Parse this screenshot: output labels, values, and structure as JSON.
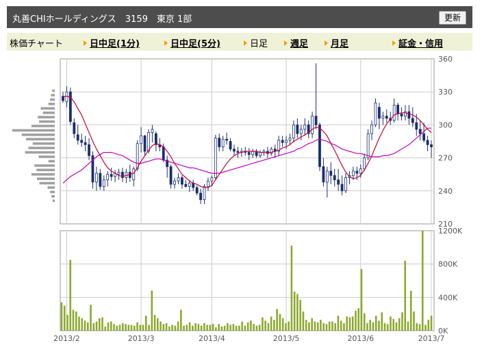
{
  "header": {
    "title": "丸善CHIホールディングス　3159　東京 1部",
    "refresh_label": "更新"
  },
  "nav": {
    "chart_label": "株価チャート",
    "items": [
      {
        "label": "日中足(1分)",
        "link": true
      },
      {
        "label": "日中足(5分)",
        "link": true
      },
      {
        "label": "日足",
        "link": false
      },
      {
        "label": "週足",
        "link": true
      },
      {
        "label": "月足",
        "link": true
      },
      {
        "label": "証金・信用",
        "link": true
      }
    ]
  },
  "colors": {
    "candle": "#1a2e6e",
    "ma_short": "#cc0033",
    "ma_long": "#c000c0",
    "volume": "#8ca82e",
    "volume_profile": "#a0a0a0",
    "grid": "#cccccc"
  },
  "chart_data": {
    "type": "candlestick",
    "price_axis": {
      "min": 210,
      "max": 360,
      "ticks": [
        210,
        240,
        270,
        300,
        330,
        360
      ]
    },
    "volume_axis": {
      "min": 0,
      "max": 1200000,
      "ticks": [
        0,
        400000,
        800000,
        1200000
      ],
      "tick_labels": [
        "0K",
        "400K",
        "800K",
        "1200K"
      ]
    },
    "x_labels": [
      "2013/2",
      "2013/3",
      "2013/4",
      "2013/5",
      "2013/6",
      "2013/7"
    ],
    "x_label_index": [
      1,
      21,
      40,
      60,
      80,
      99
    ],
    "grid": true,
    "ohlc": [
      [
        326,
        330,
        320,
        322
      ],
      [
        321,
        335,
        316,
        330
      ],
      [
        330,
        334,
        300,
        303
      ],
      [
        302,
        306,
        288,
        292
      ],
      [
        291,
        300,
        282,
        286
      ],
      [
        286,
        292,
        280,
        284
      ],
      [
        284,
        290,
        276,
        282
      ],
      [
        282,
        288,
        268,
        272
      ],
      [
        272,
        276,
        242,
        248
      ],
      [
        248,
        262,
        240,
        256
      ],
      [
        256,
        260,
        241,
        244
      ],
      [
        244,
        254,
        240,
        250
      ],
      [
        250,
        258,
        244,
        255
      ],
      [
        255,
        261,
        249,
        253
      ],
      [
        253,
        259,
        248,
        256
      ],
      [
        255,
        260,
        250,
        257
      ],
      [
        257,
        261,
        248,
        252
      ],
      [
        252,
        260,
        247,
        257
      ],
      [
        257,
        264,
        248,
        252
      ],
      [
        250,
        262,
        244,
        260
      ],
      [
        260,
        286,
        258,
        283
      ],
      [
        283,
        298,
        275,
        290
      ],
      [
        290,
        291,
        272,
        276
      ],
      [
        276,
        296,
        274,
        293
      ],
      [
        293,
        300,
        284,
        296
      ],
      [
        292,
        294,
        276,
        282
      ],
      [
        282,
        288,
        276,
        280
      ],
      [
        280,
        283,
        266,
        268
      ],
      [
        268,
        272,
        252,
        262
      ],
      [
        262,
        264,
        242,
        246
      ],
      [
        246,
        252,
        242,
        249
      ],
      [
        249,
        256,
        246,
        252
      ],
      [
        252,
        254,
        242,
        246
      ],
      [
        246,
        250,
        243,
        244
      ],
      [
        244,
        250,
        239,
        247
      ],
      [
        247,
        250,
        240,
        243
      ],
      [
        243,
        245,
        236,
        238
      ],
      [
        238,
        242,
        228,
        232
      ],
      [
        232,
        246,
        228,
        244
      ],
      [
        244,
        252,
        240,
        249
      ],
      [
        249,
        254,
        244,
        252
      ],
      [
        252,
        291,
        250,
        288
      ],
      [
        288,
        292,
        276,
        280
      ],
      [
        280,
        290,
        276,
        287
      ],
      [
        287,
        293,
        282,
        286
      ],
      [
        285,
        288,
        276,
        278
      ],
      [
        278,
        282,
        272,
        276
      ],
      [
        276,
        280,
        270,
        275
      ],
      [
        275,
        279,
        271,
        276
      ],
      [
        276,
        280,
        272,
        275
      ],
      [
        275,
        279,
        268,
        273
      ],
      [
        273,
        278,
        270,
        276
      ],
      [
        276,
        278,
        270,
        272
      ],
      [
        272,
        277,
        270,
        275
      ],
      [
        275,
        278,
        272,
        276
      ],
      [
        276,
        280,
        270,
        274
      ],
      [
        274,
        280,
        272,
        278
      ],
      [
        278,
        282,
        270,
        276
      ],
      [
        276,
        290,
        272,
        286
      ],
      [
        286,
        290,
        280,
        284
      ],
      [
        284,
        290,
        278,
        286
      ],
      [
        286,
        292,
        282,
        288
      ],
      [
        288,
        304,
        284,
        300
      ],
      [
        300,
        306,
        288,
        292
      ],
      [
        292,
        300,
        286,
        296
      ],
      [
        296,
        306,
        290,
        300
      ],
      [
        300,
        304,
        288,
        292
      ],
      [
        292,
        312,
        288,
        308
      ],
      [
        308,
        356,
        296,
        300
      ],
      [
        300,
        302,
        258,
        262
      ],
      [
        262,
        270,
        244,
        248
      ],
      [
        248,
        262,
        234,
        258
      ],
      [
        258,
        266,
        246,
        254
      ],
      [
        254,
        260,
        244,
        250
      ],
      [
        250,
        260,
        240,
        246
      ],
      [
        246,
        254,
        236,
        240
      ],
      [
        240,
        256,
        238,
        252
      ],
      [
        252,
        258,
        246,
        254
      ],
      [
        254,
        262,
        250,
        258
      ],
      [
        258,
        262,
        250,
        256
      ],
      [
        256,
        264,
        252,
        260
      ],
      [
        260,
        274,
        258,
        270
      ],
      [
        270,
        296,
        268,
        292
      ],
      [
        292,
        304,
        286,
        300
      ],
      [
        300,
        324,
        298,
        320
      ],
      [
        316,
        320,
        296,
        306
      ],
      [
        306,
        312,
        300,
        308
      ],
      [
        308,
        314,
        302,
        306
      ],
      [
        306,
        312,
        300,
        304
      ],
      [
        304,
        324,
        302,
        318
      ],
      [
        318,
        320,
        304,
        310
      ],
      [
        310,
        316,
        304,
        308
      ],
      [
        308,
        318,
        304,
        312
      ],
      [
        312,
        318,
        300,
        306
      ],
      [
        306,
        316,
        298,
        302
      ],
      [
        302,
        310,
        290,
        296
      ],
      [
        296,
        304,
        286,
        292
      ],
      [
        292,
        302,
        284,
        286
      ],
      [
        286,
        290,
        276,
        282
      ],
      [
        282,
        286,
        270,
        280
      ]
    ],
    "ma_short": [
      326,
      326,
      325,
      321,
      315,
      309,
      301,
      293,
      285,
      278,
      272,
      266,
      261,
      258,
      256,
      254,
      253,
      254,
      255,
      256,
      261,
      267,
      272,
      277,
      281,
      283,
      282,
      280,
      276,
      271,
      265,
      260,
      255,
      252,
      249,
      247,
      246,
      244,
      243,
      243,
      245,
      250,
      255,
      260,
      265,
      269,
      272,
      274,
      275,
      276,
      276,
      276,
      276,
      275,
      275,
      275,
      275,
      276,
      277,
      279,
      280,
      282,
      285,
      287,
      289,
      291,
      293,
      296,
      298,
      297,
      294,
      290,
      283,
      277,
      270,
      263,
      257,
      253,
      251,
      252,
      254,
      259,
      265,
      272,
      280,
      288,
      295,
      301,
      305,
      309,
      310,
      311,
      311,
      310,
      309,
      307,
      304,
      300,
      296,
      293
    ],
    "ma_long": [
      247,
      250,
      253,
      255,
      257,
      259,
      262,
      265,
      268,
      271,
      273,
      275,
      275,
      275,
      274,
      273,
      272,
      270,
      268,
      266,
      265,
      265,
      266,
      267,
      268,
      269,
      269,
      268,
      267,
      266,
      265,
      264,
      263,
      262,
      261,
      261,
      260,
      259,
      258,
      257,
      256,
      256,
      256,
      257,
      258,
      259,
      260,
      261,
      262,
      263,
      264,
      265,
      266,
      267,
      268,
      269,
      270,
      271,
      272,
      273,
      274,
      275,
      276,
      278,
      279,
      281,
      283,
      284,
      286,
      287,
      286,
      285,
      283,
      282,
      280,
      278,
      277,
      276,
      275,
      274,
      274,
      273,
      272,
      271,
      271,
      271,
      272,
      272,
      273,
      274,
      276,
      278,
      280,
      282,
      285,
      288,
      291,
      294,
      297,
      297
    ],
    "volume": [
      340000,
      300000,
      190000,
      850000,
      250000,
      230000,
      170000,
      150000,
      120000,
      100000,
      310000,
      90000,
      110000,
      150000,
      160000,
      50000,
      100000,
      110000,
      80000,
      60000,
      70000,
      90000,
      80000,
      70000,
      70000,
      60000,
      100000,
      70000,
      70000,
      180000,
      70000,
      480000,
      190000,
      150000,
      110000,
      80000,
      90000,
      50000,
      70000,
      60000,
      110000,
      250000,
      60000,
      70000,
      100000,
      60000,
      90000,
      80000,
      60000,
      90000,
      70000,
      70000,
      80000,
      40000,
      80000,
      50000,
      60000,
      90000,
      70000,
      80000,
      60000,
      60000,
      110000,
      60000,
      100000,
      120000,
      80000,
      60000,
      70000,
      160000,
      120000,
      90000,
      170000,
      130000,
      260000,
      200000,
      150000,
      90000,
      110000,
      1020000,
      470000,
      440000,
      370000,
      230000,
      130000,
      100000,
      150000,
      110000,
      100000,
      130000,
      90000,
      80000,
      110000,
      110000,
      90000,
      180000,
      120000,
      90000,
      170000,
      160000,
      170000,
      240000,
      270000,
      740000,
      210000,
      90000,
      130000,
      100000,
      180000,
      120000,
      220000,
      90000,
      80000,
      170000,
      140000,
      100000,
      150000,
      220000,
      840000,
      110000,
      480000,
      230000,
      90000,
      80000,
      1200000,
      70000,
      130000,
      180000
    ],
    "volume_profile": [
      {
        "price": 331,
        "vol": 0.06
      },
      {
        "price": 327,
        "vol": 0.09
      },
      {
        "price": 323,
        "vol": 0.11
      },
      {
        "price": 319,
        "vol": 0.15
      },
      {
        "price": 315,
        "vol": 0.33
      },
      {
        "price": 311,
        "vol": 0.28
      },
      {
        "price": 307,
        "vol": 0.4
      },
      {
        "price": 303,
        "vol": 0.37
      },
      {
        "price": 299,
        "vol": 0.55
      },
      {
        "price": 295,
        "vol": 1.0
      },
      {
        "price": 291,
        "vol": 0.78
      },
      {
        "price": 287,
        "vol": 0.68
      },
      {
        "price": 283,
        "vol": 0.52
      },
      {
        "price": 279,
        "vol": 0.62
      },
      {
        "price": 275,
        "vol": 0.7
      },
      {
        "price": 271,
        "vol": 0.38
      },
      {
        "price": 267,
        "vol": 0.15
      },
      {
        "price": 263,
        "vol": 0.48
      },
      {
        "price": 259,
        "vol": 0.43
      },
      {
        "price": 255,
        "vol": 0.55
      },
      {
        "price": 251,
        "vol": 0.42
      },
      {
        "price": 247,
        "vol": 0.36
      },
      {
        "price": 243,
        "vol": 0.17
      },
      {
        "price": 239,
        "vol": 0.11
      },
      {
        "price": 235,
        "vol": 0.08
      },
      {
        "price": 231,
        "vol": 0.05
      }
    ]
  }
}
